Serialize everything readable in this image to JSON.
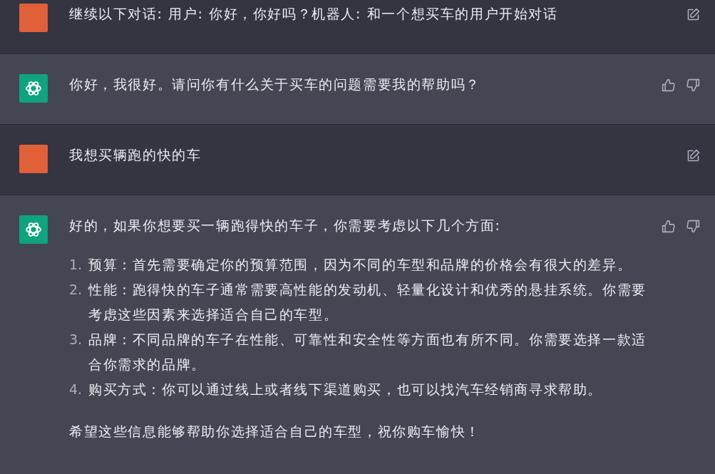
{
  "messages": [
    {
      "kind": "user",
      "text": "继续以下对话: 用户: 你好，你好吗？机器人: 和一个想买车的用户开始对话"
    },
    {
      "kind": "assistant",
      "text": "你好，我很好。请问你有什么关于买车的问题需要我的帮助吗？"
    },
    {
      "kind": "user",
      "text": "我想买辆跑的快的车"
    },
    {
      "kind": "assistant",
      "text": "好的，如果你想要买一辆跑得快的车子，你需要考虑以下几个方面:",
      "list": [
        {
          "number": "1.",
          "text": "预算：首先需要确定你的预算范围，因为不同的车型和品牌的价格会有很大的差异。"
        },
        {
          "number": "2.",
          "text": "性能：跑得快的车子通常需要高性能的发动机、轻量化设计和优秀的悬挂系统。你需要考虑这些因素来选择适合自己的车型。"
        },
        {
          "number": "3.",
          "text": "品牌：不同品牌的车子在性能、可靠性和安全性等方面也有所不同。你需要选择一款适合你需求的品牌。"
        },
        {
          "number": "4.",
          "text": "购买方式：你可以通过线上或者线下渠道购买，也可以找汽车经销商寻求帮助。"
        }
      ],
      "closing": "希望这些信息能够帮助你选择适合自己的车型，祝你购车愉快！"
    }
  ]
}
